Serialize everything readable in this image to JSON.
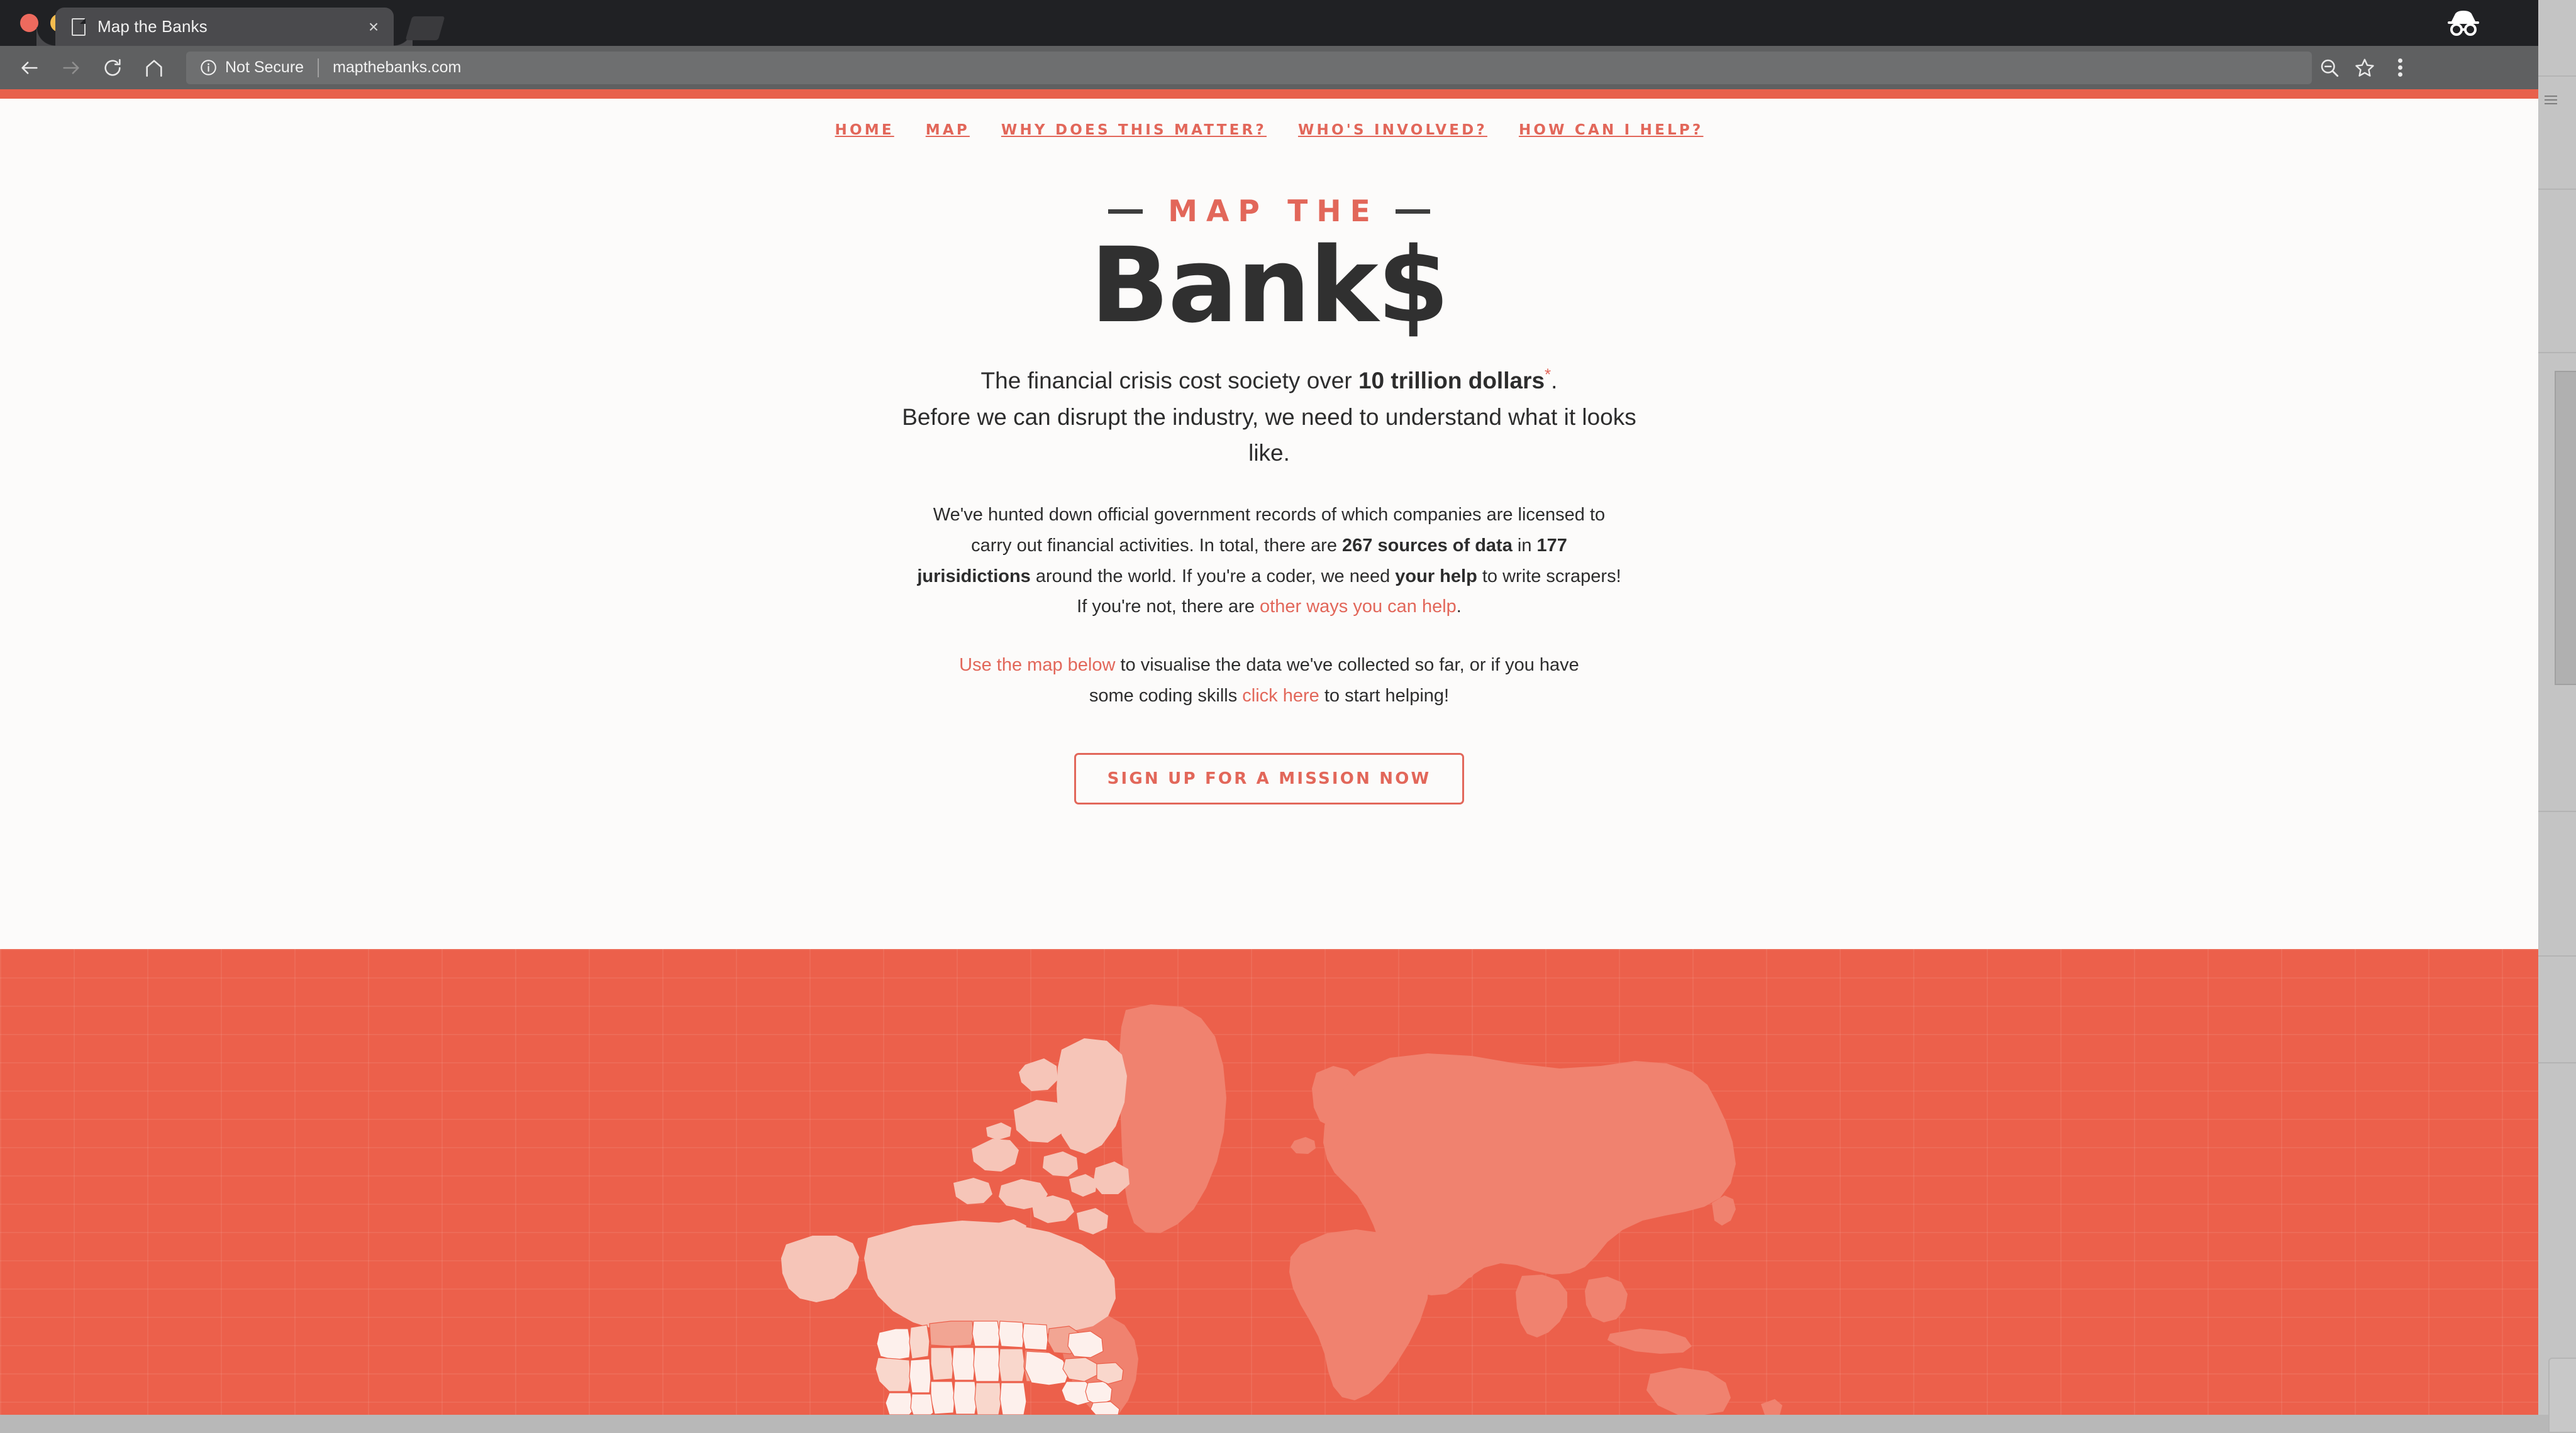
{
  "browser": {
    "traffic_lights": [
      "close",
      "minimize",
      "maximize"
    ],
    "tab": {
      "title": "Map the Banks",
      "close_label": "×",
      "favicon_name": "page-icon"
    },
    "new_tab_label": "+",
    "incognito_label": "incognito-icon",
    "toolbar": {
      "back_label": "←",
      "forward_label": "→",
      "reload_label": "⟳",
      "home_label": "⌂",
      "security_label": "Not Secure",
      "url": "mapthebanks.com",
      "zoom_out_label": "zoom-out-icon",
      "bookmark_label": "star-icon",
      "menu_label": "three-dot-menu"
    }
  },
  "site": {
    "accent_color": "#e8604c",
    "nav": [
      {
        "label": "HOME"
      },
      {
        "label": "MAP"
      },
      {
        "label": "WHY DOES THIS MATTER?"
      },
      {
        "label": "WHO'S INVOLVED?"
      },
      {
        "label": "HOW CAN I HELP?"
      }
    ],
    "logo": {
      "kicker": "MAP THE",
      "wordmark": "Bank$"
    },
    "lead": {
      "part1": "The financial crisis cost society over ",
      "highlight": "10 trillion dollars",
      "asterisk": "*",
      "part2": ".",
      "line2": "Before we can disrupt the industry, we need to understand what it looks like."
    },
    "body": {
      "p1_a": "We've hunted down official government records of which companies are licensed to carry out financial activities. In total, there are ",
      "p1_b": "267 sources of data",
      "p1_c": " in ",
      "p1_d": "177 jurisidictions",
      "p1_e": " around the world. If you're a coder, we need ",
      "p1_f": "your help",
      "p1_g": " to write scrapers! If you're not, there are ",
      "p1_link": "other ways you can help",
      "p1_h": ".",
      "p2_link1": "Use the map below",
      "p2_a": " to visualise the data we've collected so far, or if you have some coding skills ",
      "p2_link2": "click here",
      "p2_b": " to start helping!"
    },
    "cta": {
      "label": "SIGN UP FOR A MISSION NOW"
    },
    "map": {
      "background_color": "#ec604b",
      "land_far_color": "#f0826f",
      "land_near_color": "#f6c5b8",
      "land_us_color": "#fdf0ec",
      "grid_visible": "true"
    }
  }
}
